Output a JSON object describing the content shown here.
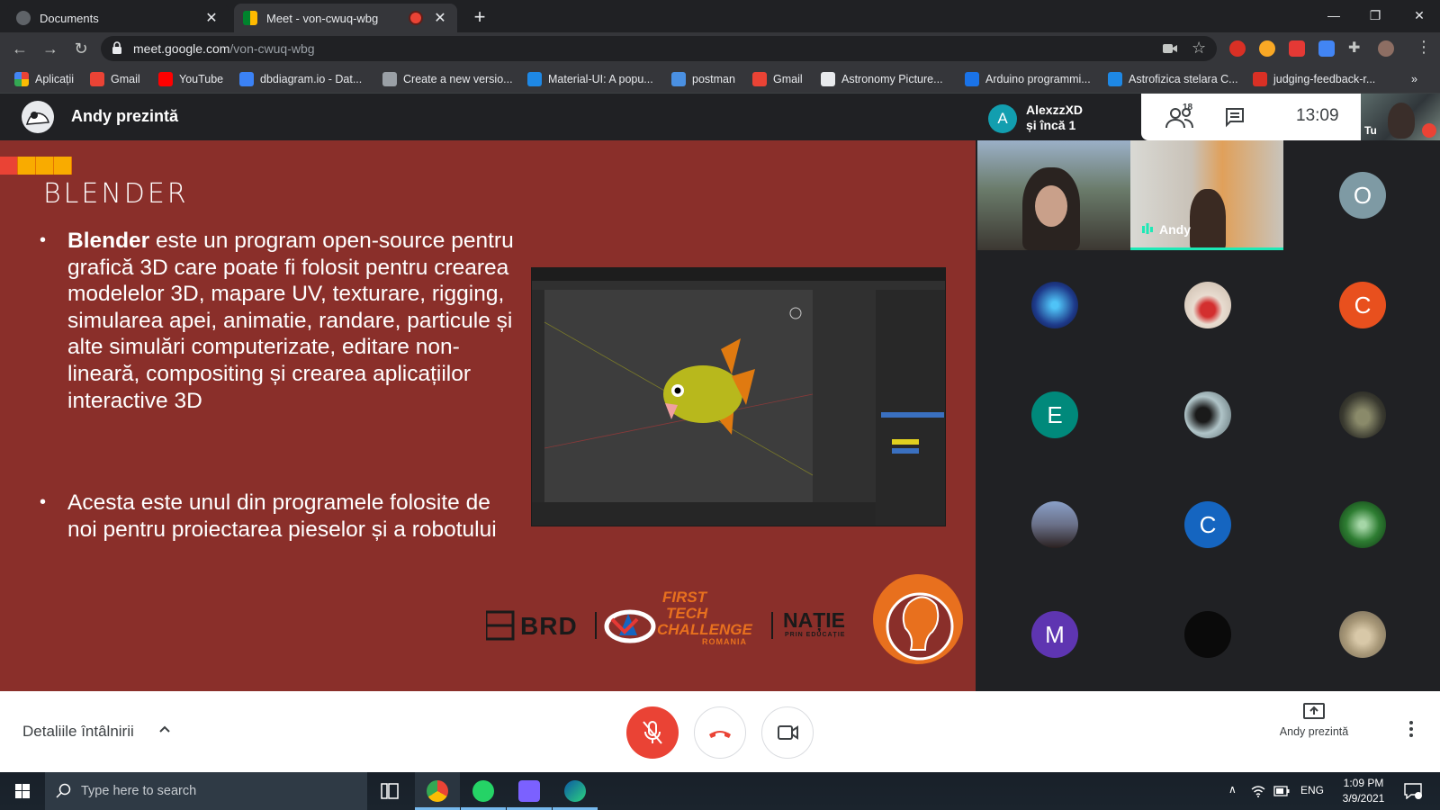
{
  "browser": {
    "tabs": [
      {
        "title": "Documents",
        "active": false
      },
      {
        "title": "Meet - von-cwuq-wbg",
        "active": true,
        "recording": true
      }
    ],
    "url_host": "meet.google.com",
    "url_path": "/von-cwuq-wbg",
    "bookmarks": [
      {
        "label": "Aplicații",
        "icon": "apps-grid-icon",
        "color": "#ea4335"
      },
      {
        "label": "Gmail",
        "icon": "gmail-icon",
        "color": "#ea4335"
      },
      {
        "label": "YouTube",
        "icon": "youtube-icon",
        "color": "#ff0000"
      },
      {
        "label": "dbdiagram.io - Dat...",
        "icon": "dbdiagram-icon",
        "color": "#3b82f6"
      },
      {
        "label": "Create a new versio...",
        "icon": "grid-doc-icon",
        "color": "#9aa0a6"
      },
      {
        "label": "Material-UI: A popu...",
        "icon": "material-ui-icon",
        "color": "#1e88e5"
      },
      {
        "label": "postman",
        "icon": "postman-icon",
        "color": "#4a90e2"
      },
      {
        "label": "Gmail",
        "icon": "gmail-icon",
        "color": "#ea4335"
      },
      {
        "label": "Astronomy Picture...",
        "icon": "astronomy-icon",
        "color": "#e8eaed"
      },
      {
        "label": "Arduino programmi...",
        "icon": "arduino-icon",
        "color": "#1a73e8"
      },
      {
        "label": "Astrofizica stelara C...",
        "icon": "astro-icon",
        "color": "#1e88e5"
      },
      {
        "label": "judging-feedback-r...",
        "icon": "judging-icon",
        "color": "#d93025"
      }
    ],
    "bookmarks_more": "»"
  },
  "meet": {
    "presenter_title": "Andy prezintă",
    "active_speaker": {
      "initial": "A",
      "name": "AlexzzXD",
      "others": "și încă 1"
    },
    "participant_count": "18",
    "time": "13:09",
    "self_label": "Tu",
    "andy_tile_label": "Andy",
    "participants": [
      {
        "kind": "initial",
        "letter": "O",
        "color": "#7e9aa4"
      },
      {
        "kind": "photo",
        "color": "#1e3a8a"
      },
      {
        "kind": "photo",
        "color": "#d9c7b8"
      },
      {
        "kind": "initial",
        "letter": "C",
        "color": "#e8501e"
      },
      {
        "kind": "initial",
        "letter": "E",
        "color": "#00897b"
      },
      {
        "kind": "photo",
        "color": "#8fa3a8"
      },
      {
        "kind": "photo",
        "color": "#4a4a3a"
      },
      {
        "kind": "photo",
        "color": "#6a7088"
      },
      {
        "kind": "initial",
        "letter": "C",
        "color": "#1565c0"
      },
      {
        "kind": "photo",
        "color": "#2e7d32"
      },
      {
        "kind": "initial",
        "letter": "M",
        "color": "#5e35b1"
      },
      {
        "kind": "photo",
        "color": "#0a0a0a"
      },
      {
        "kind": "photo",
        "color": "#b8a88a"
      }
    ],
    "details_label": "Detaliile întâlnirii",
    "present_label": "Andy prezintă"
  },
  "slide": {
    "title": "BLENDER",
    "bullet1_bold": "Blender",
    "bullet1_rest": " este un program open-source pentru grafică 3D care poate fi folosit pentru crearea modelelor 3D, mapare UV, texturare, rigging, simularea apei, animatie, randare, particule și alte simulări computerizate, editare non-lineară, compositing și crearea aplicațiilor interactive 3D",
    "bullet2": "Acesta este unul din programele folosite de noi pentru proiectarea pieselor și a robotului",
    "logos": {
      "brd": "BRD",
      "ftc_line1": "FIRST",
      "ftc_line2": "TECH",
      "ftc_line3": "CHALLENGE",
      "ftc_line4": "ROMANIA",
      "natie": "NAȚIE",
      "natie_sub": "PRIN EDUCAȚIE"
    },
    "colors": {
      "background": "#8a2f2a",
      "accent": "#e8701e"
    }
  },
  "taskbar": {
    "search_placeholder": "Type here to search",
    "lang": "ENG",
    "time": "1:09 PM",
    "date": "3/9/2021"
  }
}
